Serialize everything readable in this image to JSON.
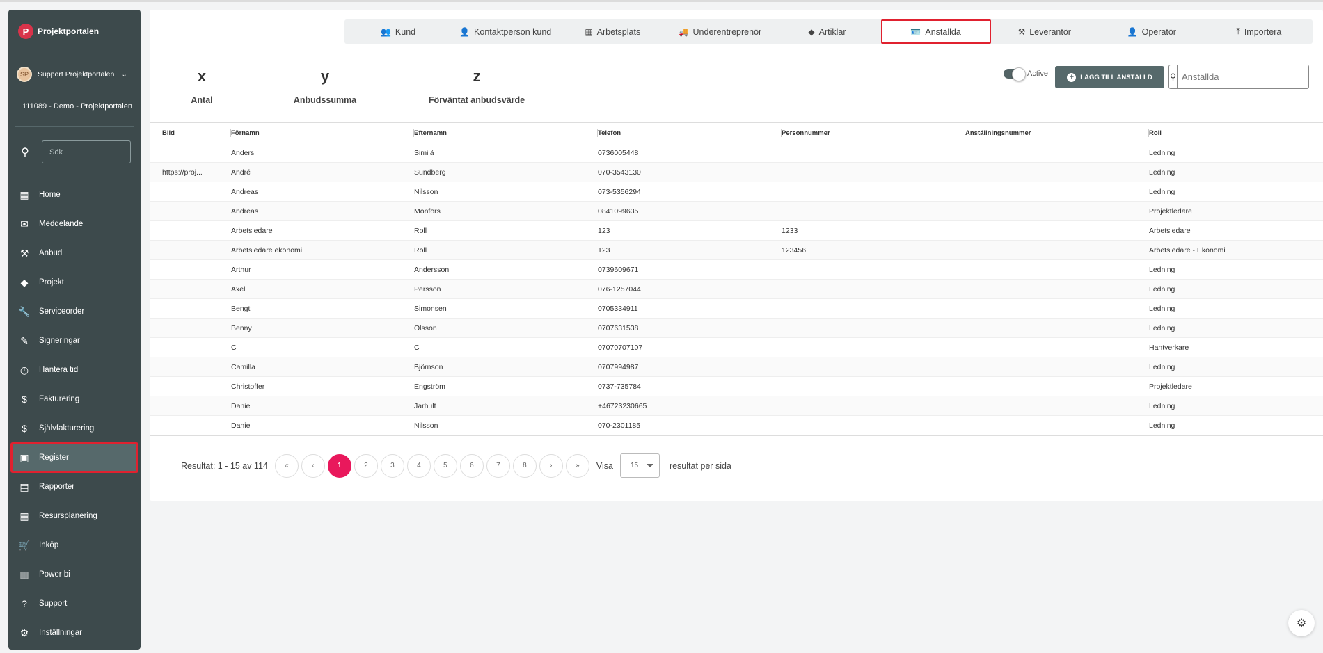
{
  "brand": {
    "name": "Projektportalen",
    "logo_letter": "P"
  },
  "user": {
    "name": "Support Projektportalen",
    "initials": "SP"
  },
  "org": "111089 - Demo - Projektportalen",
  "sidebar_search": {
    "placeholder": "Sök"
  },
  "nav": [
    {
      "label": "Home",
      "icon": "dashboard-icon",
      "glyph": "▦"
    },
    {
      "label": "Meddelande",
      "icon": "message-icon",
      "glyph": "✉"
    },
    {
      "label": "Anbud",
      "icon": "gavel-icon",
      "glyph": "⚒"
    },
    {
      "label": "Projekt",
      "icon": "widgets-icon",
      "glyph": "◆"
    },
    {
      "label": "Serviceorder",
      "icon": "wrench-icon",
      "glyph": "🔧"
    },
    {
      "label": "Signeringar",
      "icon": "note-edit-icon",
      "glyph": "✎"
    },
    {
      "label": "Hantera tid",
      "icon": "clock-icon",
      "glyph": "◷"
    },
    {
      "label": "Fakturering",
      "icon": "dollar-icon",
      "glyph": "$"
    },
    {
      "label": "Självfakturering",
      "icon": "dollar-circle-icon",
      "glyph": "$"
    },
    {
      "label": "Register",
      "icon": "image-icon",
      "glyph": "▣",
      "active": true
    },
    {
      "label": "Rapporter",
      "icon": "calendar-report-icon",
      "glyph": "▤"
    },
    {
      "label": "Resursplanering",
      "icon": "calendar-icon",
      "glyph": "▦"
    },
    {
      "label": "Inköp",
      "icon": "cart-icon",
      "glyph": "🛒"
    },
    {
      "label": "Power bi",
      "icon": "chart-icon",
      "glyph": "▥"
    },
    {
      "label": "Support",
      "icon": "help-icon",
      "glyph": "?"
    },
    {
      "label": "Inställningar",
      "icon": "gear-icon",
      "glyph": "⚙"
    }
  ],
  "tabs": [
    {
      "label": "Kund",
      "icon": "people-icon",
      "glyph": "👥"
    },
    {
      "label": "Kontaktperson kund",
      "icon": "person-icon",
      "glyph": "👤"
    },
    {
      "label": "Arbetsplats",
      "icon": "building-icon",
      "glyph": "▦"
    },
    {
      "label": "Underentreprenör",
      "icon": "truck-icon",
      "glyph": "🚚"
    },
    {
      "label": "Artiklar",
      "icon": "shapes-icon",
      "glyph": "◆"
    },
    {
      "label": "Anställda",
      "icon": "id-badge-icon",
      "glyph": "🪪",
      "active": true
    },
    {
      "label": "Leverantör",
      "icon": "tools-icon",
      "glyph": "⚒"
    },
    {
      "label": "Operatör",
      "icon": "person-gear-icon",
      "glyph": "👤"
    },
    {
      "label": "Importera",
      "icon": "upload-icon",
      "glyph": "⤒"
    }
  ],
  "stats": [
    {
      "value": "x",
      "label": "Antal"
    },
    {
      "value": "y",
      "label": "Anbudssumma"
    },
    {
      "value": "z",
      "label": "Förväntat anbudsvärde"
    }
  ],
  "toggle_label": "Active",
  "add_button": "LÄGG TILL ANSTÄLLD",
  "search": {
    "placeholder": "Anställda"
  },
  "table": {
    "columns": [
      "Bild",
      "Förnamn",
      "Efternamn",
      "Telefon",
      "Personnummer",
      "Anställningsnummer",
      "Roll"
    ],
    "rows": [
      [
        "",
        "Anders",
        "Similä",
        "0736005448",
        "",
        "",
        "Ledning"
      ],
      [
        "https://proj...",
        "André",
        "Sundberg",
        "070-3543130",
        "",
        "",
        "Ledning"
      ],
      [
        "",
        "Andreas",
        "Nilsson",
        "073-5356294",
        "",
        "",
        "Ledning"
      ],
      [
        "",
        "Andreas",
        "Monfors",
        "0841099635",
        "",
        "",
        "Projektledare"
      ],
      [
        "",
        "Arbetsledare",
        "Roll",
        "123",
        "1233",
        "",
        "Arbetsledare"
      ],
      [
        "",
        "Arbetsledare ekonomi",
        "Roll",
        "123",
        "123456",
        "",
        "Arbetsledare - Ekonomi"
      ],
      [
        "",
        "Arthur",
        "Andersson",
        "0739609671",
        "",
        "",
        "Ledning"
      ],
      [
        "",
        "Axel",
        "Persson",
        "076-1257044",
        "",
        "",
        "Ledning"
      ],
      [
        "",
        "Bengt",
        "Simonsen",
        "0705334911",
        "",
        "",
        "Ledning"
      ],
      [
        "",
        "Benny",
        "Olsson",
        "0707631538",
        "",
        "",
        "Ledning"
      ],
      [
        "",
        "C",
        "C",
        "07070707107",
        "",
        "",
        "Hantverkare"
      ],
      [
        "",
        "Camilla",
        "Björnson",
        "0707994987",
        "",
        "",
        "Ledning"
      ],
      [
        "",
        "Christoffer",
        "Engström",
        "0737-735784",
        "",
        "",
        "Projektledare"
      ],
      [
        "",
        "Daniel",
        "Jarhult",
        "+46723230665",
        "",
        "",
        "Ledning"
      ],
      [
        "",
        "Daniel",
        "Nilsson",
        "070-2301185",
        "",
        "",
        "Ledning"
      ]
    ]
  },
  "pagination": {
    "result_text": "Resultat: 1 - 15 av 114",
    "buttons": [
      "«",
      "‹",
      "1",
      "2",
      "3",
      "4",
      "5",
      "6",
      "7",
      "8",
      "›",
      "»"
    ],
    "active": "1",
    "visa": "Visa",
    "per_page_value": "15",
    "per_page_text": "resultat per sida"
  },
  "colors": {
    "sidebar": "#3d4a4c",
    "accent": "#e9185c",
    "button": "#56696b",
    "highlight": "#e0212f"
  }
}
